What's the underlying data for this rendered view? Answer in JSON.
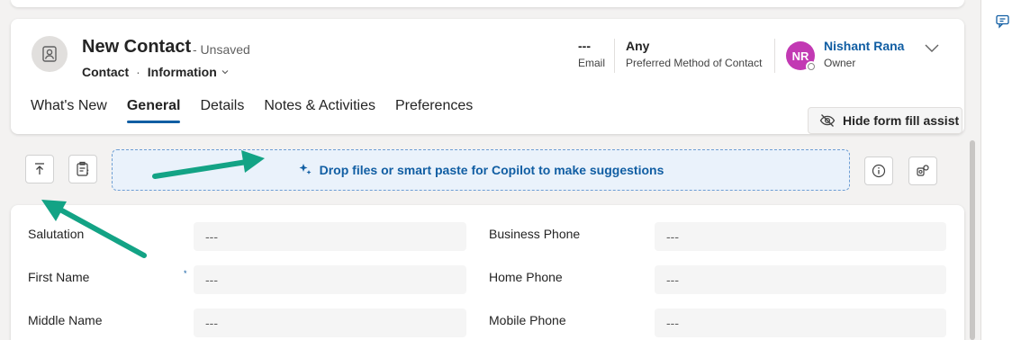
{
  "header": {
    "title": "New Contact",
    "title_status": "- Unsaved",
    "entity": "Contact",
    "separator": "·",
    "form_selector": "Information",
    "fields": [
      {
        "value": "---",
        "label": "Email"
      },
      {
        "value": "Any",
        "label": "Preferred Method of Contact"
      }
    ],
    "owner": {
      "initials": "NR",
      "name": "Nishant Rana",
      "label": "Owner"
    }
  },
  "tabs": [
    {
      "label": "What's New",
      "active": false
    },
    {
      "label": "General",
      "active": true
    },
    {
      "label": "Details",
      "active": false
    },
    {
      "label": "Notes & Activities",
      "active": false
    },
    {
      "label": "Preferences",
      "active": false
    }
  ],
  "hide_assist_label": "Hide form fill assist",
  "copilot": {
    "dropzone_text": "Drop files or smart paste for Copilot to make suggestions"
  },
  "fields": {
    "left": [
      {
        "label": "Salutation",
        "value": "---",
        "required": false
      },
      {
        "label": "First Name",
        "value": "---",
        "required": true
      },
      {
        "label": "Middle Name",
        "value": "---",
        "required": false
      }
    ],
    "right": [
      {
        "label": "Business Phone",
        "value": "---"
      },
      {
        "label": "Home Phone",
        "value": "---"
      },
      {
        "label": "Mobile Phone",
        "value": "---"
      }
    ],
    "required_marker": "*"
  },
  "colors": {
    "accent": "#115ea3",
    "owner_avatar": "#c239b3",
    "annotation_arrow": "#13a385"
  },
  "icons": [
    "contact-card-icon",
    "chevron-down-icon",
    "eye-off-icon",
    "upload-to-top-icon",
    "form-fill-icon",
    "sparkle-icon",
    "info-icon",
    "entity-map-icon",
    "chat-icon"
  ]
}
